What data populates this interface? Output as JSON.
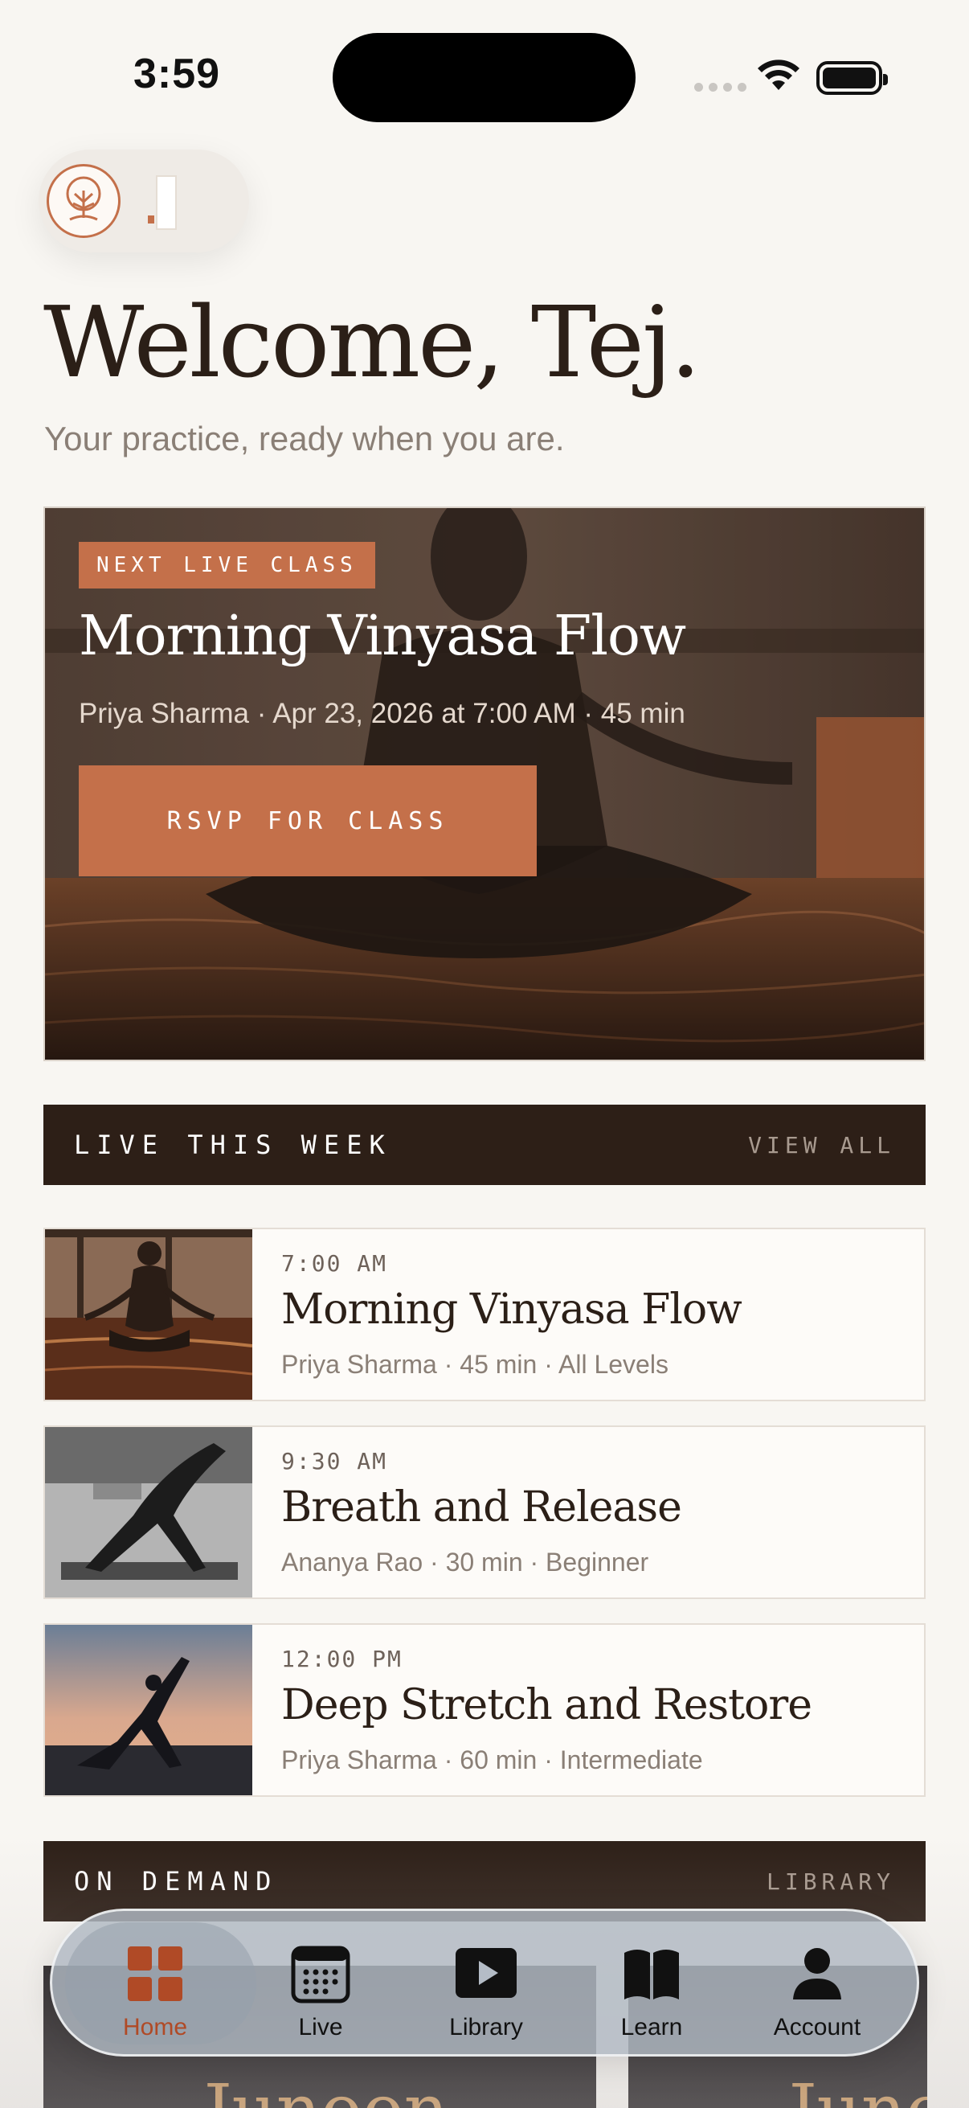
{
  "status_bar": {
    "time": "3:59"
  },
  "header": {
    "welcome": "Welcome, Tej.",
    "subtitle": "Your practice, ready when you are."
  },
  "hero": {
    "tag": "NEXT LIVE CLASS",
    "title": "Morning Vinyasa Flow",
    "meta": "Priya Sharma · Apr 23, 2026 at 7:00 AM · 45 min",
    "button": "RSVP FOR CLASS"
  },
  "live_section": {
    "title": "LIVE THIS WEEK",
    "link": "VIEW ALL",
    "classes": [
      {
        "time": "7:00 AM",
        "title": "Morning Vinyasa Flow",
        "meta": "Priya Sharma · 45 min · All Levels"
      },
      {
        "time": "9:30 AM",
        "title": "Breath and Release",
        "meta": "Ananya Rao · 30 min · Beginner"
      },
      {
        "time": "12:00 PM",
        "title": "Deep Stretch and Restore",
        "meta": "Priya Sharma · 60 min · Intermediate"
      }
    ]
  },
  "ondemand_section": {
    "title": "ON DEMAND",
    "link": "LIBRARY",
    "cards": [
      {
        "text": "Junoon"
      },
      {
        "text": "Junoon"
      }
    ]
  },
  "tabbar": {
    "items": [
      {
        "label": "Home",
        "icon": "home-grid-icon",
        "active": true
      },
      {
        "label": "Live",
        "icon": "calendar-icon",
        "active": false
      },
      {
        "label": "Library",
        "icon": "play-icon",
        "active": false
      },
      {
        "label": "Learn",
        "icon": "book-icon",
        "active": false
      },
      {
        "label": "Account",
        "icon": "person-icon",
        "active": false
      }
    ]
  },
  "colors": {
    "accent": "#c4704a",
    "dark": "#2d1f17",
    "background": "#f8f6f2"
  }
}
